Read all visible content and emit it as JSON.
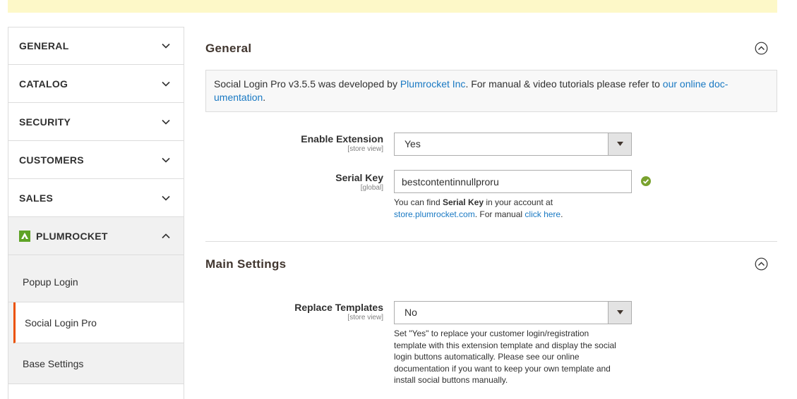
{
  "sidebar": {
    "sections": [
      {
        "label": "GENERAL"
      },
      {
        "label": "CATALOG"
      },
      {
        "label": "SECURITY"
      },
      {
        "label": "CUSTOMERS"
      },
      {
        "label": "SALES"
      },
      {
        "label": "PLUMROCKET"
      }
    ],
    "sub_items": [
      {
        "label": "Popup Login"
      },
      {
        "label": "Social Login Pro"
      },
      {
        "label": "Base Settings"
      }
    ]
  },
  "general": {
    "title": "General",
    "info": {
      "prefix": "Social Login Pro v3.5.5 was developed by ",
      "vendor_link": "Plumrocket Inc",
      "middle": ". For manual & video tutorials please refer to ",
      "doc_link_1": "our online doc-",
      "doc_link_2": "umentation",
      "suffix": "."
    },
    "enable_extension": {
      "label": "Enable Extension",
      "scope": "[store view]",
      "value": "Yes"
    },
    "serial_key": {
      "label": "Serial Key",
      "scope": "[global]",
      "value": "bestcontentinnullproru",
      "note_1": "You can find ",
      "note_bold": "Serial Key",
      "note_2": " in your account at",
      "note_link_1": "store.plumrocket.com",
      "note_3": ". For manual ",
      "note_link_2": "click here",
      "note_4": "."
    }
  },
  "main_settings": {
    "title": "Main Settings",
    "replace_templates": {
      "label": "Replace Templates",
      "scope": "[store view]",
      "value": "No",
      "note": [
        "Set \"Yes\" to replace your customer login/registration",
        "template with this extension template and display the social",
        "login buttons automatically. Please see our online",
        "documentation if you want to keep your own template and",
        "install social buttons manually."
      ]
    }
  },
  "colors": {
    "accent": "#eb5202",
    "link": "#1979c3",
    "success": "#79a22e",
    "brand": "#5ea326"
  }
}
